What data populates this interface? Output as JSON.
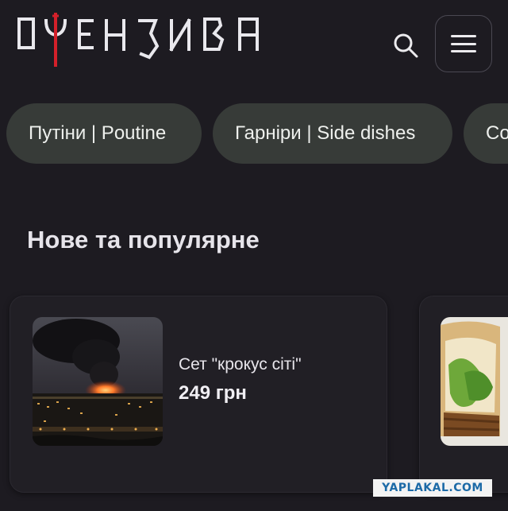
{
  "header": {
    "logo_text": "ОФЕНЗИВА",
    "icons": {
      "search": "search-icon",
      "menu": "hamburger-menu-icon"
    },
    "colors": {
      "logo": "#e9e8ed",
      "logo_accent": "#d4202a"
    }
  },
  "categories": [
    {
      "label": "Путіни | Poutine"
    },
    {
      "label": "Гарніри | Side dishes"
    },
    {
      "label": "Co"
    }
  ],
  "section": {
    "title": "Нове та популярне"
  },
  "products": [
    {
      "name": "Сет \"крокус сіті\"",
      "price": "249 грн",
      "image": "night-fire-smoke-photo"
    },
    {
      "name": "",
      "price": "",
      "image": "sandwich-photo"
    }
  ],
  "watermark": {
    "text": "YAPLAKAL.COM"
  },
  "colors": {
    "background": "#1d1b21",
    "chip": "#373b38",
    "card": "#211f25"
  }
}
